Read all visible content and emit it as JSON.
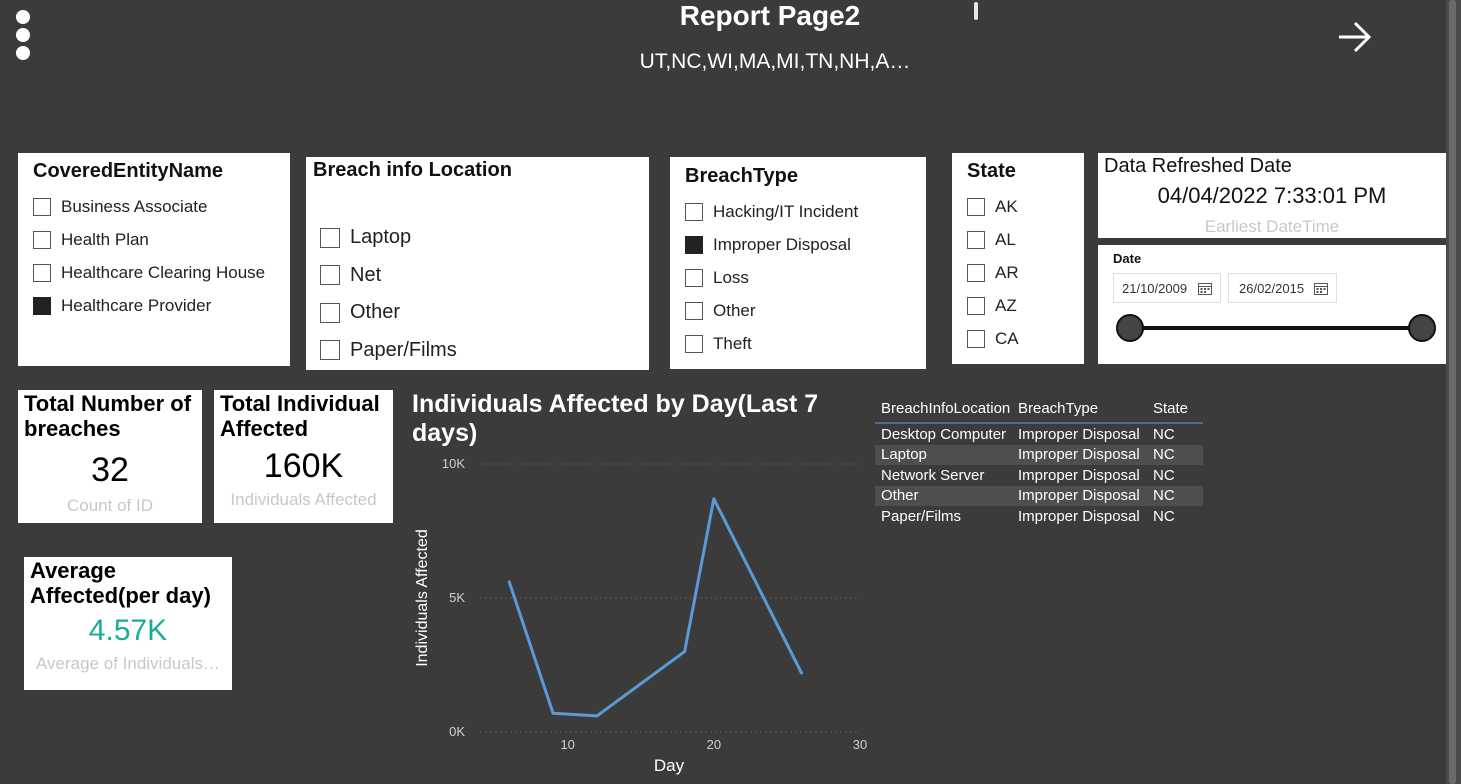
{
  "header": {
    "title": "Report Page2",
    "subtitle": "UT,NC,WI,MA,MI,TN,NH,A…"
  },
  "covered_entity": {
    "title": "CoveredEntityName",
    "options": [
      {
        "label": "Business Associate",
        "checked": false
      },
      {
        "label": "Health Plan",
        "checked": false
      },
      {
        "label": "Healthcare Clearing House",
        "checked": false
      },
      {
        "label": "Healthcare Provider",
        "checked": true
      }
    ]
  },
  "breach_location": {
    "title": "Breach info Location",
    "options": [
      {
        "label": "Laptop",
        "checked": false
      },
      {
        "label": "Net",
        "checked": false
      },
      {
        "label": "Other",
        "checked": false
      },
      {
        "label": "Paper/Films",
        "checked": false
      }
    ]
  },
  "breach_type": {
    "title": "BreachType",
    "options": [
      {
        "label": "Hacking/IT Incident",
        "checked": false
      },
      {
        "label": "Improper Disposal",
        "checked": true
      },
      {
        "label": "Loss",
        "checked": false
      },
      {
        "label": "Other",
        "checked": false
      },
      {
        "label": "Theft",
        "checked": false
      }
    ]
  },
  "state": {
    "title": "State",
    "options": [
      {
        "label": "AK",
        "checked": false
      },
      {
        "label": "AL",
        "checked": false
      },
      {
        "label": "AR",
        "checked": false
      },
      {
        "label": "AZ",
        "checked": false
      },
      {
        "label": "CA",
        "checked": false
      }
    ]
  },
  "refresh": {
    "title": "Data Refreshed Date",
    "value": "04/04/2022 7:33:01 PM",
    "caption": "Earliest DateTime"
  },
  "date_slicer": {
    "title": "Date",
    "start": "21/10/2009",
    "end": "26/02/2015"
  },
  "kpis": {
    "total_breaches": {
      "title": "Total Number of breaches",
      "value": "32",
      "caption": "Count of ID"
    },
    "total_affected": {
      "title": "Total Individual Affected",
      "value": "160K",
      "caption": "Individuals Affected"
    },
    "average_affected": {
      "title": "Average Affected(per day)",
      "value": "4.57K",
      "caption": "Average of Individuals…",
      "color": "#1aab9b"
    }
  },
  "chart_data": {
    "type": "line",
    "title": "Individuals Affected by Day(Last 7 days)",
    "xlabel": "Day",
    "ylabel": "Individuals Affected",
    "xlim": [
      4,
      30
    ],
    "ylim": [
      0,
      10000
    ],
    "x_ticks": [
      "10",
      "20",
      "30"
    ],
    "y_ticks": [
      "0K",
      "5K",
      "10K"
    ],
    "line_color": "#5b9bd5",
    "points": [
      {
        "x": 6,
        "y": 5600
      },
      {
        "x": 9,
        "y": 700
      },
      {
        "x": 12,
        "y": 600
      },
      {
        "x": 18,
        "y": 3000
      },
      {
        "x": 20,
        "y": 8700
      },
      {
        "x": 26,
        "y": 2200
      }
    ]
  },
  "table": {
    "headers": [
      "BreachInfoLocation",
      "BreachType",
      "State"
    ],
    "rows": [
      [
        "Desktop Computer",
        "Improper Disposal",
        "NC"
      ],
      [
        "Laptop",
        "Improper Disposal",
        "NC"
      ],
      [
        "Network Server",
        "Improper Disposal",
        "NC"
      ],
      [
        "Other",
        "Improper Disposal",
        "NC"
      ],
      [
        "Paper/Films",
        "Improper Disposal",
        "NC"
      ]
    ]
  }
}
